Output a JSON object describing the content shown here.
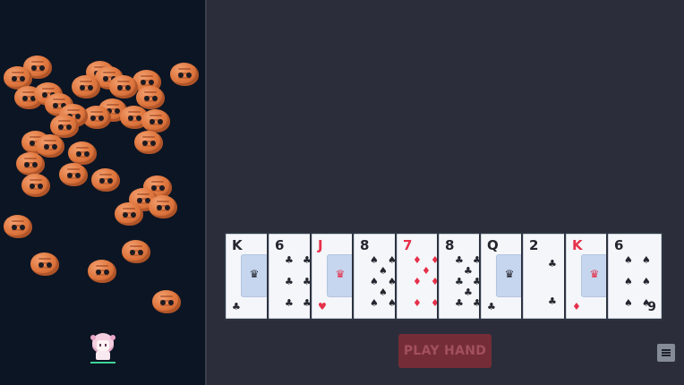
{
  "arena": {
    "enemy_type": "orange-blob-enemy",
    "enemy_color": "#e07840",
    "background": "#0c1523",
    "player": {
      "sprite": "pink-haired-girl",
      "health_color": "#3fd39a"
    }
  },
  "hand": {
    "cards": [
      {
        "rank": "K",
        "suit": "clubs",
        "color": "black"
      },
      {
        "rank": "6",
        "suit": "clubs",
        "color": "black"
      },
      {
        "rank": "J",
        "suit": "hearts",
        "color": "red"
      },
      {
        "rank": "8",
        "suit": "spades",
        "color": "black"
      },
      {
        "rank": "7",
        "suit": "diamonds",
        "color": "red"
      },
      {
        "rank": "8",
        "suit": "clubs",
        "color": "black"
      },
      {
        "rank": "Q",
        "suit": "clubs",
        "color": "black"
      },
      {
        "rank": "2",
        "suit": "clubs",
        "color": "black"
      },
      {
        "rank": "K",
        "suit": "diamonds",
        "color": "red"
      },
      {
        "rank": "6",
        "suit": "spades",
        "color": "black",
        "bottom_rank": "9"
      }
    ]
  },
  "controls": {
    "play_hand_label": "PLAY HAND",
    "menu_icon": "hamburger-menu-icon"
  },
  "colors": {
    "table": "#2b2e3a",
    "play_button_bg": "#742d36",
    "red_suit": "#e6304a"
  }
}
